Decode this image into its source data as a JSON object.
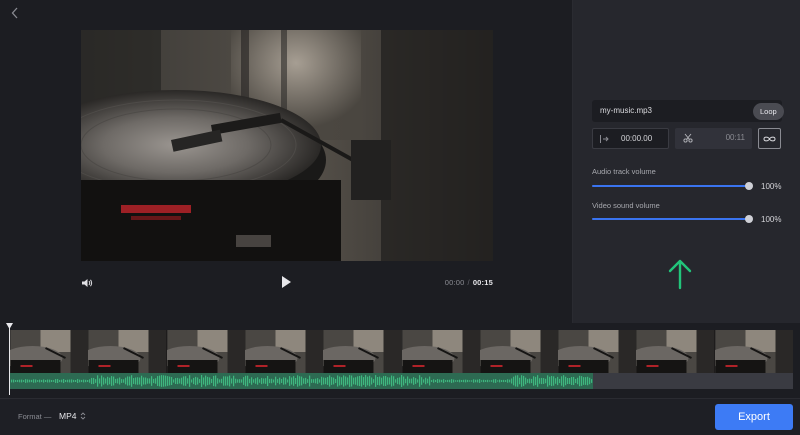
{
  "player": {
    "current_time": "00:00",
    "separator": "/",
    "duration": "00:15"
  },
  "audio": {
    "file_name": "my-music.mp3",
    "start_time": "00:00.00",
    "end_time": "00:11",
    "loop_tooltip": "Loop",
    "track_volume_label": "Audio track volume",
    "track_volume_value": "100%",
    "track_volume_fraction": 1.0,
    "video_volume_label": "Video sound volume",
    "video_volume_value": "100%",
    "video_volume_fraction": 1.0,
    "audio_track_fraction": 0.745
  },
  "timeline": {
    "frame_count": 10
  },
  "footer": {
    "format_label": "Format —",
    "format_value": "MP4",
    "export_label": "Export"
  },
  "colors": {
    "accent": "#3d7bf5",
    "audio_wave": "#3fb77f",
    "arrow_indicator": "#22c47a"
  }
}
